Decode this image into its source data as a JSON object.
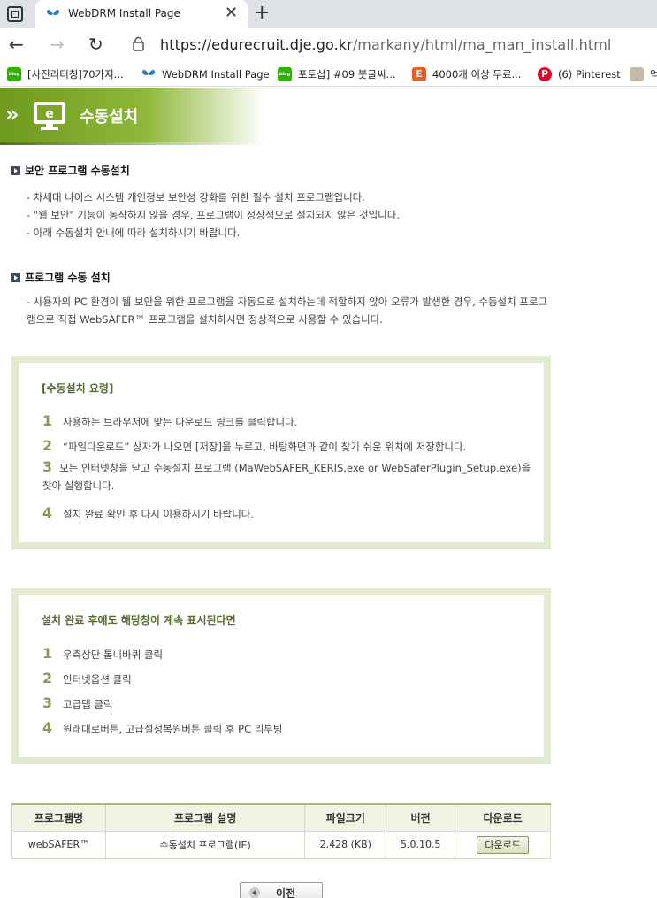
{
  "browser": {
    "tab_title": "WebDRM Install Page",
    "close_glyph": "✕",
    "new_tab_glyph": "+",
    "back_glyph": "←",
    "forward_glyph": "→",
    "reload_glyph": "↻",
    "url_host": "https://edurecruit.dje.go.kr",
    "url_path": "/markany/html/ma_man_install.html",
    "bookmarks": [
      {
        "label": "[사진리터칭]70가지...",
        "icon": "naver-blog-icon"
      },
      {
        "label": "WebDRM Install Page",
        "icon": "butterfly-icon"
      },
      {
        "label": "포토샵] #09 붓글씨...",
        "icon": "naver-blog-icon"
      },
      {
        "label": "4000개 이상 무료...",
        "icon": "e-icon"
      },
      {
        "label": "(6) Pinterest",
        "icon": "pinterest-icon"
      },
      {
        "label": "억",
        "icon": "thumbnail-icon"
      }
    ],
    "blog_badge": "blog",
    "e_badge": "E",
    "p_badge": "P"
  },
  "banner": {
    "chevrons": "»",
    "monitor_letter": "e",
    "title": "수동설치"
  },
  "section1": {
    "title": "보안 프로그램 수동설치",
    "lines": [
      "- 차세대 나이스 시스템 개인정보 보안성 강화를 위한 필수 설치 프로그램입니다.",
      "- \"웹 보안\" 기능이 동작하지 않을 경우, 프로그램이 정상적으로 설치되지 않은 것입니다.",
      "- 아래 수동설치 안내에 따라 설치하시기 바랍니다."
    ]
  },
  "section2": {
    "title": "프로그램 수동 설치",
    "paragraph": "- 사용자의 PC 환경이 웹 보안을 위한 프로그램을 자동으로 설치하는데 적합하지 않아 오류가 발생한 경우, 수동설치 프로그램으로 직접 WebSAFER™ 프로그램을 설치하시면 정상적으로 사용할 수 있습니다."
  },
  "box1": {
    "heading": "[수동설치 요령]",
    "steps": [
      {
        "num": "1",
        "text": "사용하는 브라우저에 맞는 다운로드 링크를 클릭합니다."
      },
      {
        "num": "2",
        "text": "“파일다운로드” 상자가 나오면 [저장]을 누르고, 바탕화면과 같이 찾기 쉬운 위치에 저장합니다."
      },
      {
        "num": "3",
        "text": "모든 인터넷창을 닫고 수동설치 프로그램 (MaWebSAFER_KERIS.exe or WebSaferPlugin_Setup.exe)을 찾아 실행합니다."
      },
      {
        "num": "4",
        "text": "설치 완료 확인 후 다시 이용하시기 바랍니다."
      }
    ]
  },
  "box2": {
    "heading": "설치 완료 후에도 해당창이 계속 표시된다면",
    "steps": [
      {
        "num": "1",
        "text": "우측상단 톱니바퀴 클릭"
      },
      {
        "num": "2",
        "text": "인터넷옵션 클릭"
      },
      {
        "num": "3",
        "text": "고급탭 클릭"
      },
      {
        "num": "4",
        "text": "원래대로버튼, 고급설정복원버튼 클릭 후 PC 리부팅"
      }
    ]
  },
  "table": {
    "headers": [
      "프로그램명",
      "프로그램 설명",
      "파일크기",
      "버전",
      "다운로드"
    ],
    "row": {
      "name": "webSAFER™",
      "desc": "수동설치 프로그램(IE)",
      "size": "2,428 (KB)",
      "version": "5.0.10.5",
      "download": "다운로드"
    }
  },
  "prev_button": "이전"
}
